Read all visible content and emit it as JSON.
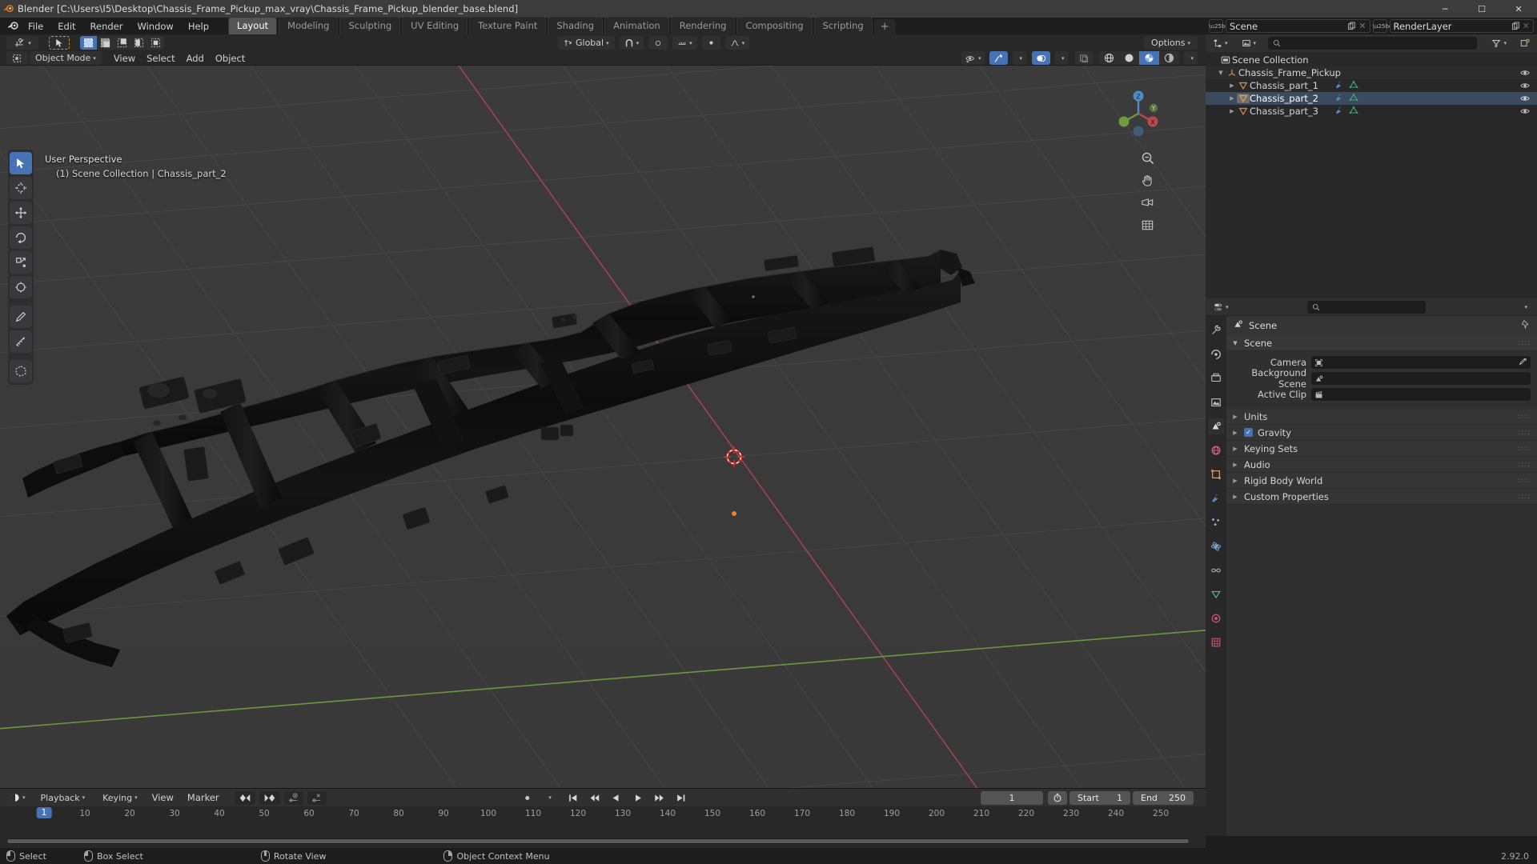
{
  "window": {
    "title": "Blender [C:\\Users\\I5\\Desktop\\Chassis_Frame_Pickup_max_vray\\Chassis_Frame_Pickup_blender_base.blend]",
    "minimize": "─",
    "maximize": "☐",
    "close": "✕"
  },
  "topbar": {
    "menus": [
      "File",
      "Edit",
      "Render",
      "Window",
      "Help"
    ],
    "workspaces": [
      {
        "label": "Layout",
        "active": true
      },
      {
        "label": "Modeling",
        "active": false
      },
      {
        "label": "Sculpting",
        "active": false
      },
      {
        "label": "UV Editing",
        "active": false
      },
      {
        "label": "Texture Paint",
        "active": false
      },
      {
        "label": "Shading",
        "active": false
      },
      {
        "label": "Animation",
        "active": false
      },
      {
        "label": "Rendering",
        "active": false
      },
      {
        "label": "Compositing",
        "active": false
      },
      {
        "label": "Scripting",
        "active": false
      }
    ],
    "add_workspace": "+"
  },
  "scene_bar": {
    "scene_name": "Scene",
    "view_layer_name": "RenderLayer"
  },
  "viewport_header": {
    "editor_type": "editor-type-3dview",
    "mode": "Object Mode",
    "menus": [
      "View",
      "Select",
      "Add",
      "Object"
    ],
    "transform_orientation": "Global",
    "options_label": "Options",
    "snap_label": "snap",
    "proportional_label": "proportional-editing"
  },
  "viewport": {
    "perspective_label": "User Perspective",
    "scene_info": "(1) Scene Collection | Chassis_part_2",
    "gizmo_axes": [
      "X",
      "Y",
      "Z"
    ],
    "background_color": "#3b3b3b",
    "grid_color": "#4a4a4a",
    "x_axis_color": "#a33b47",
    "y_axis_color": "#6a9e3f",
    "tools": [
      {
        "name": "tweak-select-tool",
        "active": true
      },
      {
        "name": "cursor-tool",
        "active": false
      },
      {
        "name": "move-tool",
        "active": false
      },
      {
        "name": "rotate-tool",
        "active": false
      },
      {
        "name": "scale-tool",
        "active": false
      },
      {
        "name": "transform-tool",
        "active": false
      },
      {
        "name": "annotate-tool",
        "active": false
      },
      {
        "name": "measure-tool",
        "active": false
      },
      {
        "name": "add-cube-tool",
        "active": false
      }
    ]
  },
  "outliner": {
    "display_mode": "View Layer",
    "search_placeholder": "",
    "rows": [
      {
        "label": "Scene Collection",
        "indent": 0,
        "icon": "collection-icon",
        "expand": "",
        "selected": false,
        "eye": false,
        "badges": []
      },
      {
        "label": "Chassis_Frame_Pickup",
        "indent": 1,
        "icon": "empty-axis-icon",
        "expand": "▼",
        "selected": false,
        "eye": true,
        "badges": []
      },
      {
        "label": "Chassis_part_1",
        "indent": 2,
        "icon": "mesh-object-icon",
        "expand": "▶",
        "selected": false,
        "eye": true,
        "badges": [
          "modifier-icon",
          "mesh-data-icon"
        ]
      },
      {
        "label": "Chassis_part_2",
        "indent": 2,
        "icon": "mesh-object-icon",
        "expand": "▶",
        "selected": true,
        "eye": true,
        "badges": [
          "modifier-icon",
          "mesh-data-icon"
        ]
      },
      {
        "label": "Chassis_part_3",
        "indent": 2,
        "icon": "mesh-object-icon",
        "expand": "▶",
        "selected": false,
        "eye": true,
        "badges": [
          "modifier-icon",
          "mesh-data-icon"
        ]
      }
    ]
  },
  "properties": {
    "search_placeholder": "",
    "breadcrumb": "Scene",
    "tabs": [
      {
        "name": "tool-tab",
        "glyph": "⚒",
        "color": "#c8c8c8",
        "active": false
      },
      {
        "name": "render-tab",
        "glyph": "▣",
        "color": "#c8c8c8",
        "active": false
      },
      {
        "name": "output-tab",
        "glyph": "⎙",
        "color": "#c8c8c8",
        "active": false
      },
      {
        "name": "view-layer-tab",
        "glyph": "❐",
        "color": "#c8c8c8",
        "active": false
      },
      {
        "name": "scene-tab",
        "glyph": "◔",
        "color": "#d8d8d8",
        "active": true
      },
      {
        "name": "world-tab",
        "glyph": "●",
        "color": "#e0667a",
        "active": false
      },
      {
        "name": "object-tab",
        "glyph": "▭",
        "color": "#e09a5a",
        "active": false
      },
      {
        "name": "modifier-tab",
        "glyph": "⚙",
        "color": "#6d9fe0",
        "active": false
      },
      {
        "name": "particles-tab",
        "glyph": "⁂",
        "color": "#9ab7d8",
        "active": false
      },
      {
        "name": "physics-tab",
        "glyph": "⦿",
        "color": "#7fa8d8",
        "active": false
      },
      {
        "name": "constraints-tab",
        "glyph": "⛓",
        "color": "#b0b0b0",
        "active": false
      },
      {
        "name": "data-tab",
        "glyph": "▽",
        "color": "#4cb98a",
        "active": false
      },
      {
        "name": "material-tab",
        "glyph": "●",
        "color": "#d05a6e",
        "active": false
      },
      {
        "name": "texture-tab",
        "glyph": "▒",
        "color": "#d05a6e",
        "active": false
      }
    ],
    "panel_title": "Scene",
    "fields": [
      {
        "label": "Camera",
        "value": "",
        "icon": "camera-icon",
        "eyedropper": true
      },
      {
        "label": "Background Scene",
        "value": "",
        "icon": "scene-icon",
        "eyedropper": false
      },
      {
        "label": "Active Clip",
        "value": "",
        "icon": "clip-icon",
        "eyedropper": false
      }
    ],
    "sections": [
      {
        "label": "Units",
        "checkbox": false,
        "checked": false
      },
      {
        "label": "Gravity",
        "checkbox": true,
        "checked": true
      },
      {
        "label": "Keying Sets",
        "checkbox": false,
        "checked": false
      },
      {
        "label": "Audio",
        "checkbox": false,
        "checked": false
      },
      {
        "label": "Rigid Body World",
        "checkbox": false,
        "checked": false
      },
      {
        "label": "Custom Properties",
        "checkbox": false,
        "checked": false
      }
    ]
  },
  "timeline": {
    "editor_type": "timeline-editor",
    "menus": [
      "Playback",
      "Keying",
      "View",
      "Marker"
    ],
    "current_frame": "1",
    "start_label": "Start",
    "start_value": "1",
    "end_label": "End",
    "end_value": "250",
    "ticks": [
      "10",
      "20",
      "30",
      "40",
      "50",
      "60",
      "70",
      "80",
      "90",
      "100",
      "110",
      "120",
      "130",
      "140",
      "150",
      "160",
      "170",
      "180",
      "190",
      "200",
      "210",
      "220",
      "230",
      "240",
      "250"
    ],
    "playhead_frame": "1"
  },
  "statusbar": {
    "items": [
      {
        "mouse": "left",
        "label": "Select"
      },
      {
        "mouse": "left",
        "label": "Box Select"
      },
      {
        "mouse": "middle",
        "label": "Rotate View"
      },
      {
        "mouse": "right",
        "label": "Object Context Menu"
      }
    ],
    "version": "2.92.0"
  }
}
